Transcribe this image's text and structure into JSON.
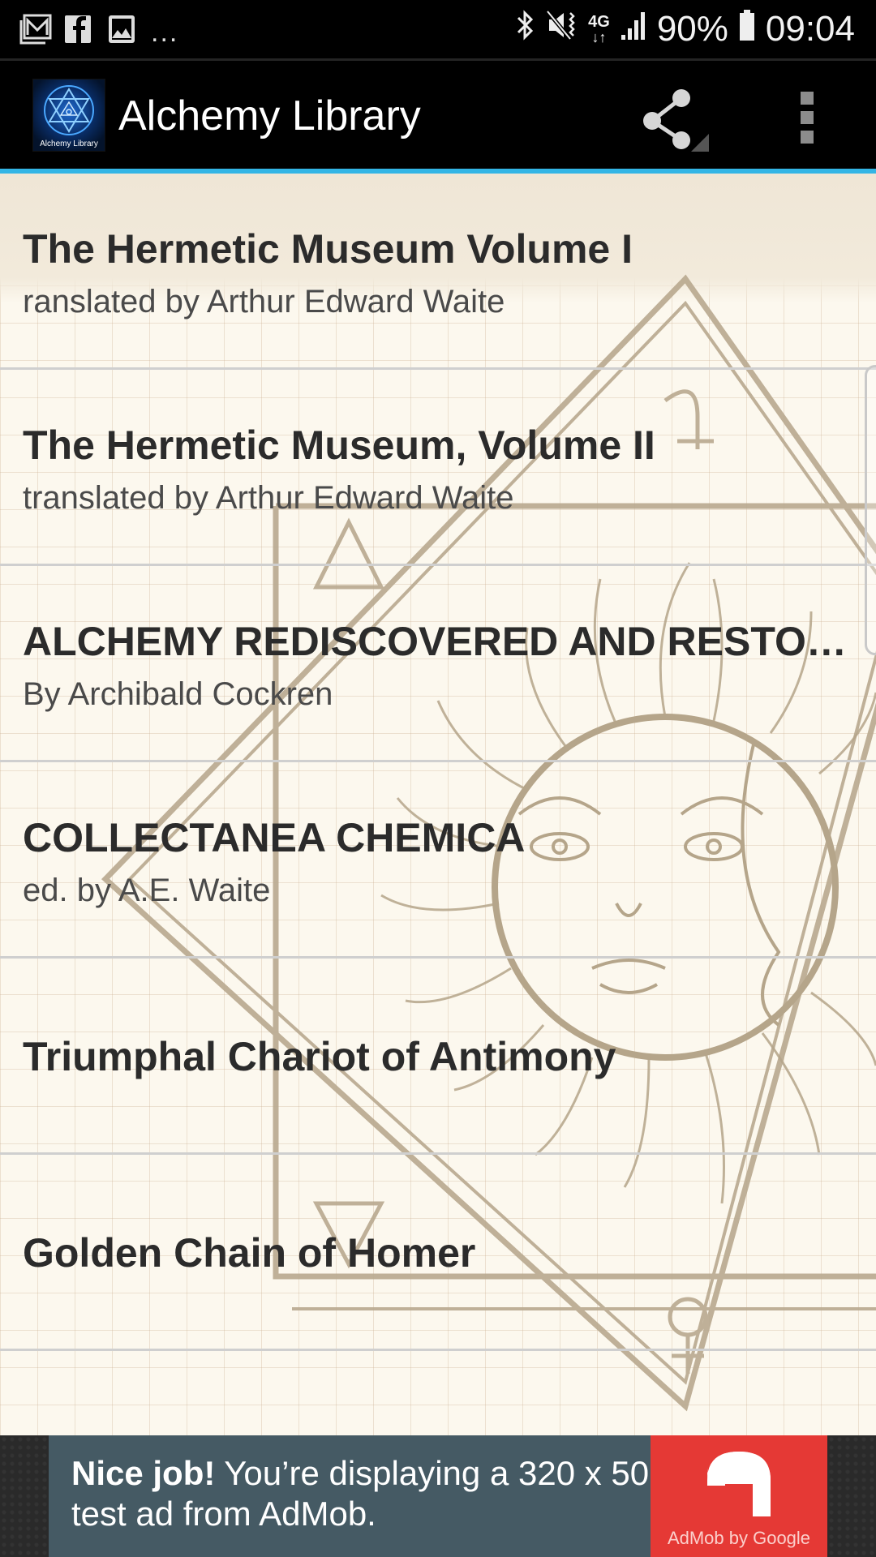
{
  "status_bar": {
    "notifications": [
      "gmail-icon",
      "facebook-icon",
      "gallery-icon"
    ],
    "more": "...",
    "network": "4G",
    "battery": "90%",
    "time": "09:04"
  },
  "app_bar": {
    "logo_text": "Alchemy Library",
    "title": "Alchemy Library"
  },
  "books": [
    {
      "title": "The Hermetic Museum Volume I",
      "subtitle": "ranslated by Arthur Edward Waite"
    },
    {
      "title": "The Hermetic Museum, Volume II",
      "subtitle": "translated by Arthur Edward Waite"
    },
    {
      "title": "ALCHEMY REDISCOVERED AND RESTORED",
      "subtitle": "By Archibald Cockren"
    },
    {
      "title": "COLLECTANEA CHEMICA",
      "subtitle": "ed. by A.E. Waite"
    },
    {
      "title": "Triumphal Chariot of Antimony",
      "subtitle": ""
    },
    {
      "title": "Golden Chain of Homer",
      "subtitle": ""
    }
  ],
  "ad": {
    "headline": "Nice job!",
    "body": " You’re displaying a 320 x 50 test ad from AdMob.",
    "brand": "AdMob by Google"
  },
  "colors": {
    "accent": "#33b5e5",
    "ad_background": "#455a64",
    "ad_brand": "#e53935",
    "art": "#b5a58a"
  }
}
